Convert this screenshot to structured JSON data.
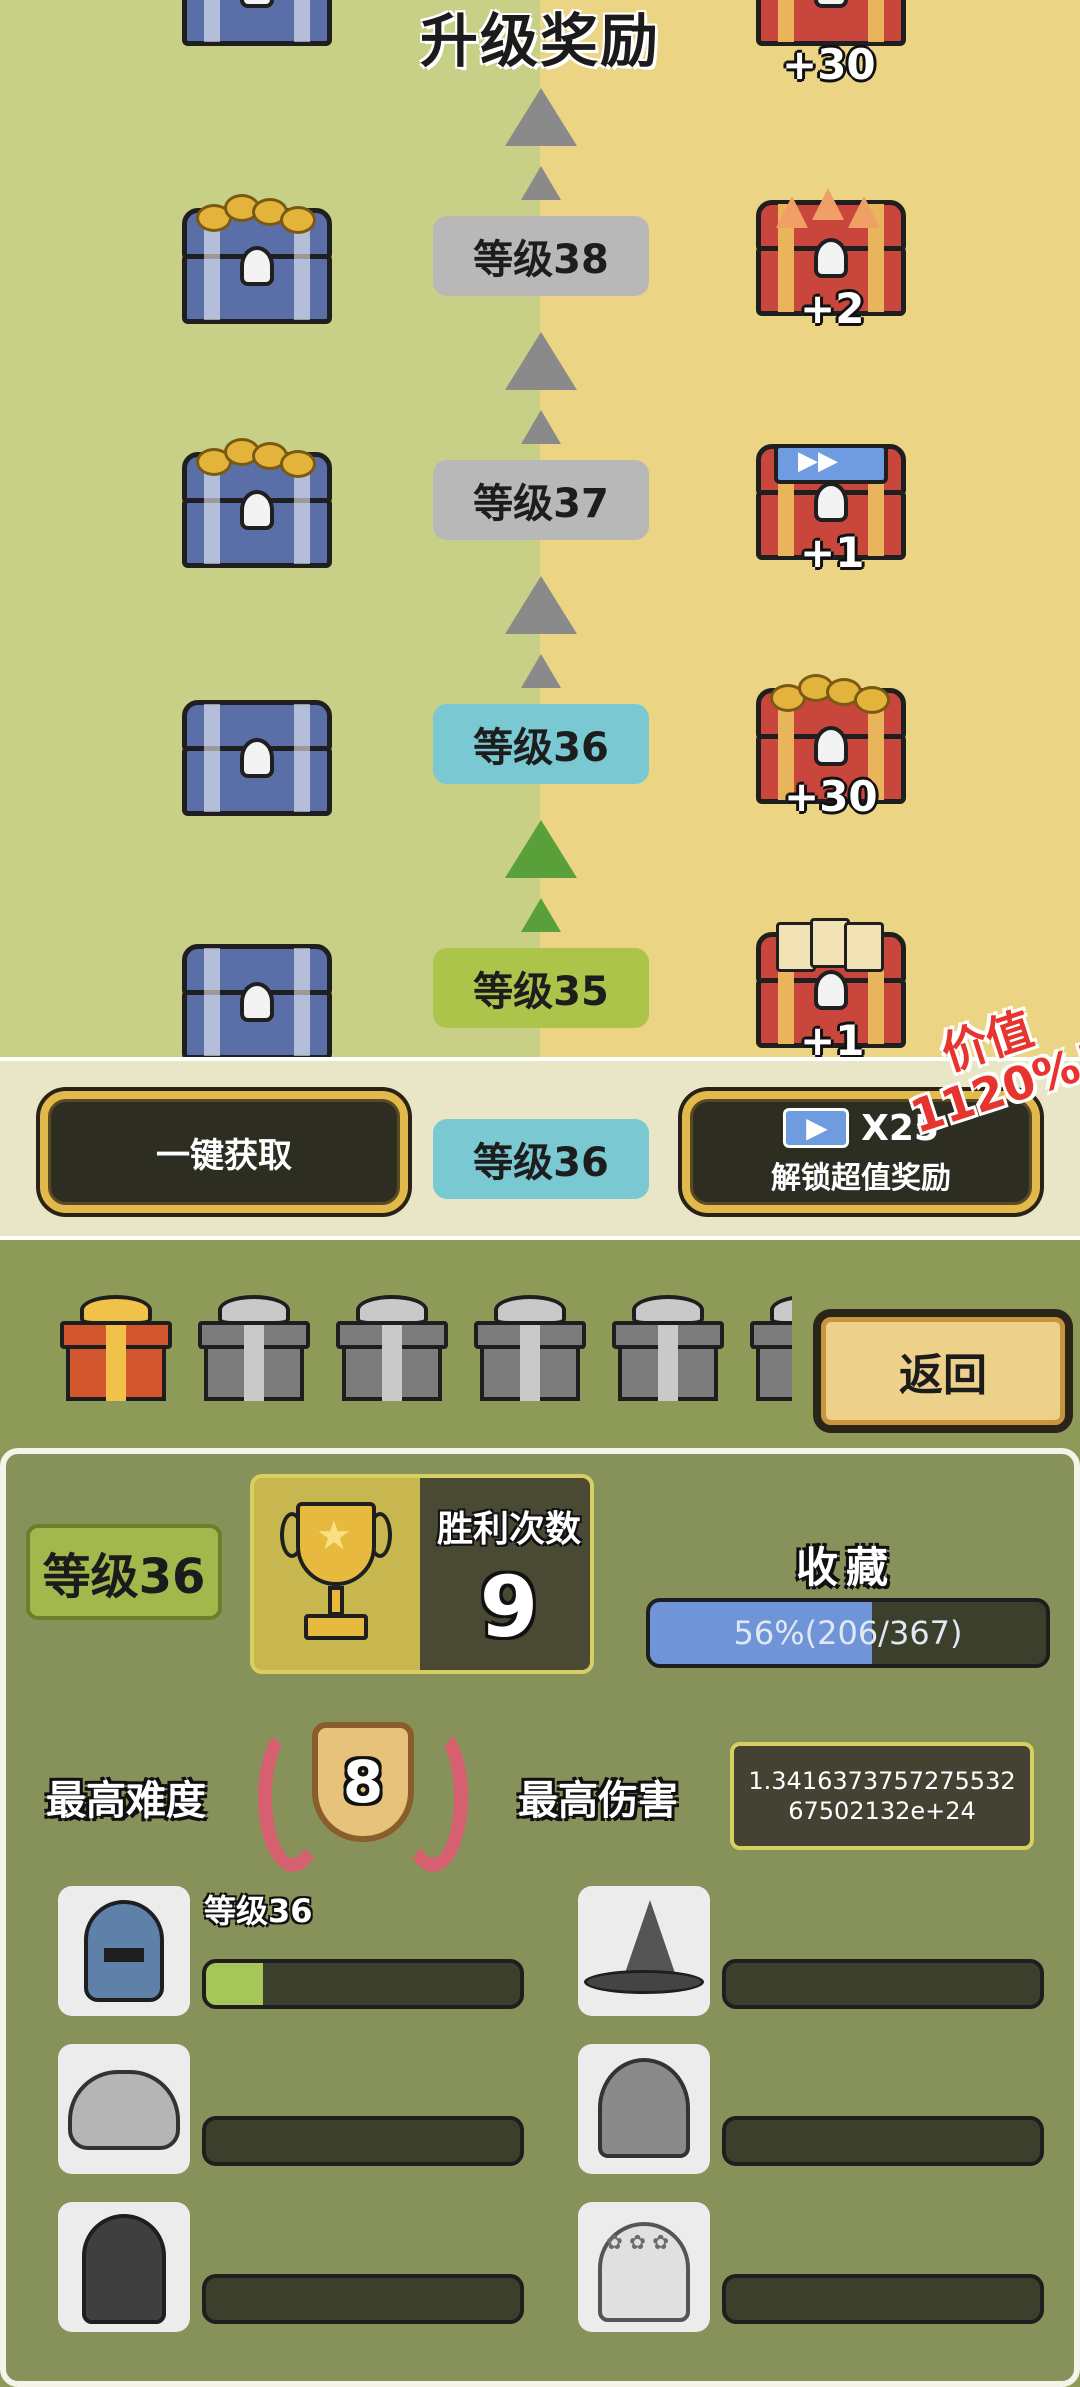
{
  "track": {
    "title": "升级奖励",
    "rows": [
      {
        "level_label": "等级38",
        "pill_style": "gray",
        "arrow_style": "gray",
        "free_reward": "coin-chest",
        "paid_reward": "shard-chest",
        "paid_qty": "+2"
      },
      {
        "level_label": "等级37",
        "pill_style": "gray",
        "arrow_style": "gray",
        "free_reward": "coin-chest",
        "paid_reward": "ticket-chest",
        "paid_qty": "+1"
      },
      {
        "level_label": "等级36",
        "pill_style": "cyan",
        "arrow_style": "gray",
        "free_reward": "empty-chest",
        "paid_reward": "coin-chest",
        "paid_qty": "+30"
      },
      {
        "level_label": "等级35",
        "pill_style": "lime",
        "arrow_style": "green",
        "free_reward": "empty-chest",
        "paid_reward": "card-chest",
        "paid_qty": "+1"
      }
    ],
    "top_partial_qty": "+30"
  },
  "claim_bar": {
    "claim_all_label": "一键获取",
    "current_level_label": "等级36",
    "unlock_multiplier": "X25",
    "unlock_label": "解锁超值奖励",
    "value_tag": "价值1120%!"
  },
  "gift_strip": {
    "gifts": [
      "gold",
      "gray",
      "gray",
      "gray",
      "gray",
      "gray"
    ],
    "back_label": "返回"
  },
  "stats": {
    "level_badge": "等级36",
    "wins_label": "胜利次数",
    "wins_value": "9",
    "collection_label": "收藏",
    "collection_text": "56%(206/367)",
    "collection_progress": 0.56,
    "max_difficulty_label": "最高难度",
    "max_difficulty_value": "8",
    "max_damage_label": "最高伤害",
    "max_damage_value": "1.341637375727553267502132e+24",
    "slots": [
      {
        "icon": "knight-helmet-icon",
        "level_label": "等级36",
        "progress": 0.18
      },
      {
        "icon": "witch-hat-icon",
        "level_label": "",
        "progress": 0
      },
      {
        "icon": "turban-icon",
        "level_label": "",
        "progress": 0
      },
      {
        "icon": "pointed-helmet-icon",
        "level_label": "",
        "progress": 0
      },
      {
        "icon": "dark-hood-icon",
        "level_label": "",
        "progress": 0
      },
      {
        "icon": "wreath-hood-icon",
        "level_label": "",
        "progress": 0
      }
    ]
  }
}
